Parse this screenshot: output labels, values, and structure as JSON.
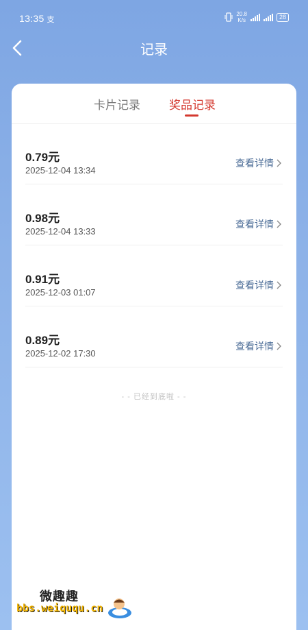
{
  "status_bar": {
    "time": "13:35",
    "extra": "支",
    "speed_value": "20.8",
    "speed_unit": "K/s",
    "battery": "28"
  },
  "header": {
    "title": "记录"
  },
  "tabs": [
    {
      "label": "卡片记录",
      "active": false
    },
    {
      "label": "奖品记录",
      "active": true
    }
  ],
  "records": [
    {
      "amount": "0.79元",
      "date": "2025-12-04 13:34",
      "action": "查看详情"
    },
    {
      "amount": "0.98元",
      "date": "2025-12-04 13:33",
      "action": "查看详情"
    },
    {
      "amount": "0.91元",
      "date": "2025-12-03 01:07",
      "action": "查看详情"
    },
    {
      "amount": "0.89元",
      "date": "2025-12-02 17:30",
      "action": "查看详情"
    }
  ],
  "end_note": "- - 已经到底啦 - -",
  "watermark": {
    "top": "微趣趣",
    "bottom": "bbs.weiququ.cn"
  },
  "colors": {
    "accent": "#d4392f",
    "link": "#4a6b96",
    "background": "#8db2e8"
  }
}
